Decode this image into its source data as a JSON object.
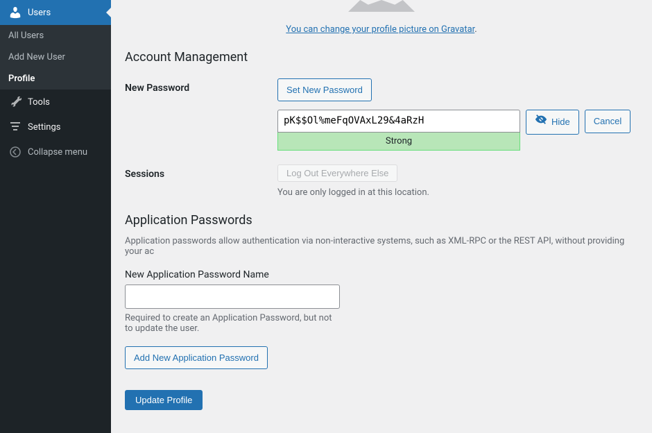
{
  "sidebar": {
    "users": {
      "label": "Users",
      "submenu": {
        "all": "All Users",
        "add": "Add New User",
        "profile": "Profile"
      }
    },
    "tools": "Tools",
    "settings": "Settings",
    "collapse": "Collapse menu"
  },
  "gravatar": {
    "link_text": "You can change your profile picture on Gravatar",
    "period": "."
  },
  "account": {
    "heading": "Account Management",
    "new_password_label": "New Password",
    "set_password_btn": "Set New Password",
    "password_value": "pK$$Ol%meFqOVAxL29&4aRzH",
    "strength": "Strong",
    "hide_btn": "Hide",
    "cancel_btn": "Cancel",
    "sessions_label": "Sessions",
    "logout_btn": "Log Out Everywhere Else",
    "sessions_desc": "You are only logged in at this location."
  },
  "app_passwords": {
    "heading": "Application Passwords",
    "desc": "Application passwords allow authentication via non-interactive systems, such as XML-RPC or the REST API, without providing your ac",
    "name_label": "New Application Password Name",
    "name_hint": "Required to create an Application Password, but not to update the user.",
    "add_btn": "Add New Application Password"
  },
  "submit": {
    "update": "Update Profile"
  }
}
